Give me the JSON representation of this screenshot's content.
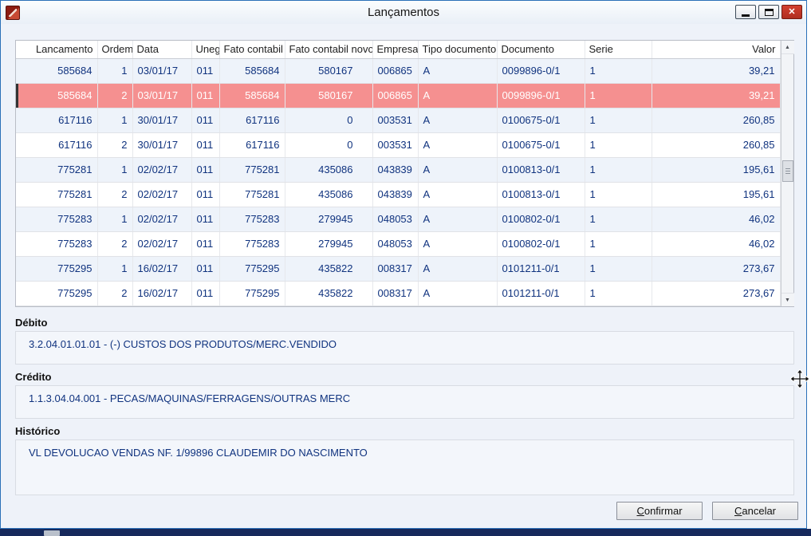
{
  "window": {
    "title": "Lançamentos",
    "controls": {
      "minimize": "minimize-icon",
      "maximize": "maximize-icon",
      "close": "close-icon"
    }
  },
  "table": {
    "columns": [
      {
        "key": "lancamento",
        "label": "Lancamento",
        "align": "right",
        "header_align": "right"
      },
      {
        "key": "ordem",
        "label": "Ordem",
        "align": "right",
        "header_align": "left"
      },
      {
        "key": "data",
        "label": "Data",
        "align": "left",
        "header_align": "left"
      },
      {
        "key": "uneg",
        "label": "Uneg",
        "align": "left",
        "header_align": "left"
      },
      {
        "key": "fato_contabil",
        "label": "Fato contabil",
        "align": "right",
        "header_align": "left"
      },
      {
        "key": "fato_contabil_novo",
        "label": "Fato contabil novo",
        "align": "right",
        "header_align": "left"
      },
      {
        "key": "empresa",
        "label": "Empresa",
        "align": "left",
        "header_align": "left"
      },
      {
        "key": "tipo_documento",
        "label": "Tipo documento",
        "align": "left",
        "header_align": "left"
      },
      {
        "key": "documento",
        "label": "Documento",
        "align": "left",
        "header_align": "left"
      },
      {
        "key": "serie",
        "label": "Serie",
        "align": "left",
        "header_align": "left"
      },
      {
        "key": "valor",
        "label": "Valor",
        "align": "right",
        "header_align": "right"
      }
    ],
    "rows": [
      [
        "585684",
        "1",
        "03/01/17",
        "011",
        "585684",
        "580167",
        "006865",
        "A",
        "0099896-0/1",
        "1",
        "39,21"
      ],
      [
        "585684",
        "2",
        "03/01/17",
        "011",
        "585684",
        "580167",
        "006865",
        "A",
        "0099896-0/1",
        "1",
        "39,21"
      ],
      [
        "617116",
        "1",
        "30/01/17",
        "011",
        "617116",
        "0",
        "003531",
        "A",
        "0100675-0/1",
        "1",
        "260,85"
      ],
      [
        "617116",
        "2",
        "30/01/17",
        "011",
        "617116",
        "0",
        "003531",
        "A",
        "0100675-0/1",
        "1",
        "260,85"
      ],
      [
        "775281",
        "1",
        "02/02/17",
        "011",
        "775281",
        "435086",
        "043839",
        "A",
        "0100813-0/1",
        "1",
        "195,61"
      ],
      [
        "775281",
        "2",
        "02/02/17",
        "011",
        "775281",
        "435086",
        "043839",
        "A",
        "0100813-0/1",
        "1",
        "195,61"
      ],
      [
        "775283",
        "1",
        "02/02/17",
        "011",
        "775283",
        "279945",
        "048053",
        "A",
        "0100802-0/1",
        "1",
        "46,02"
      ],
      [
        "775283",
        "2",
        "02/02/17",
        "011",
        "775283",
        "279945",
        "048053",
        "A",
        "0100802-0/1",
        "1",
        "46,02"
      ],
      [
        "775295",
        "1",
        "16/02/17",
        "011",
        "775295",
        "435822",
        "008317",
        "A",
        "0101211-0/1",
        "1",
        "273,67"
      ],
      [
        "775295",
        "2",
        "16/02/17",
        "011",
        "775295",
        "435822",
        "008317",
        "A",
        "0101211-0/1",
        "1",
        "273,67"
      ]
    ],
    "selected_row_index": 1
  },
  "sections": {
    "debito": {
      "label": "Débito",
      "value": "3.2.04.01.01.01 - (-) CUSTOS DOS PRODUTOS/MERC.VENDIDO"
    },
    "credito": {
      "label": "Crédito",
      "value": "1.1.3.04.04.001 - PECAS/MAQUINAS/FERRAGENS/OUTRAS MERC"
    },
    "historico": {
      "label": "Histórico",
      "value": "VL DEVOLUCAO VENDAS NF. 1/99896 CLAUDEMIR DO NASCIMENTO"
    }
  },
  "buttons": {
    "confirm": "Confirmar",
    "cancel": "Cancelar"
  },
  "scrollbar": {
    "up_icon": "▲",
    "down_icon": "▼"
  },
  "close_glyph": "✕",
  "colors": {
    "accent_text": "#10337f",
    "selected_row_bg": "#f59090",
    "selected_row_text": "#ffffff",
    "close_button": "#d2402f",
    "taskbar": "#16295c",
    "window_border": "#2a70b8"
  }
}
